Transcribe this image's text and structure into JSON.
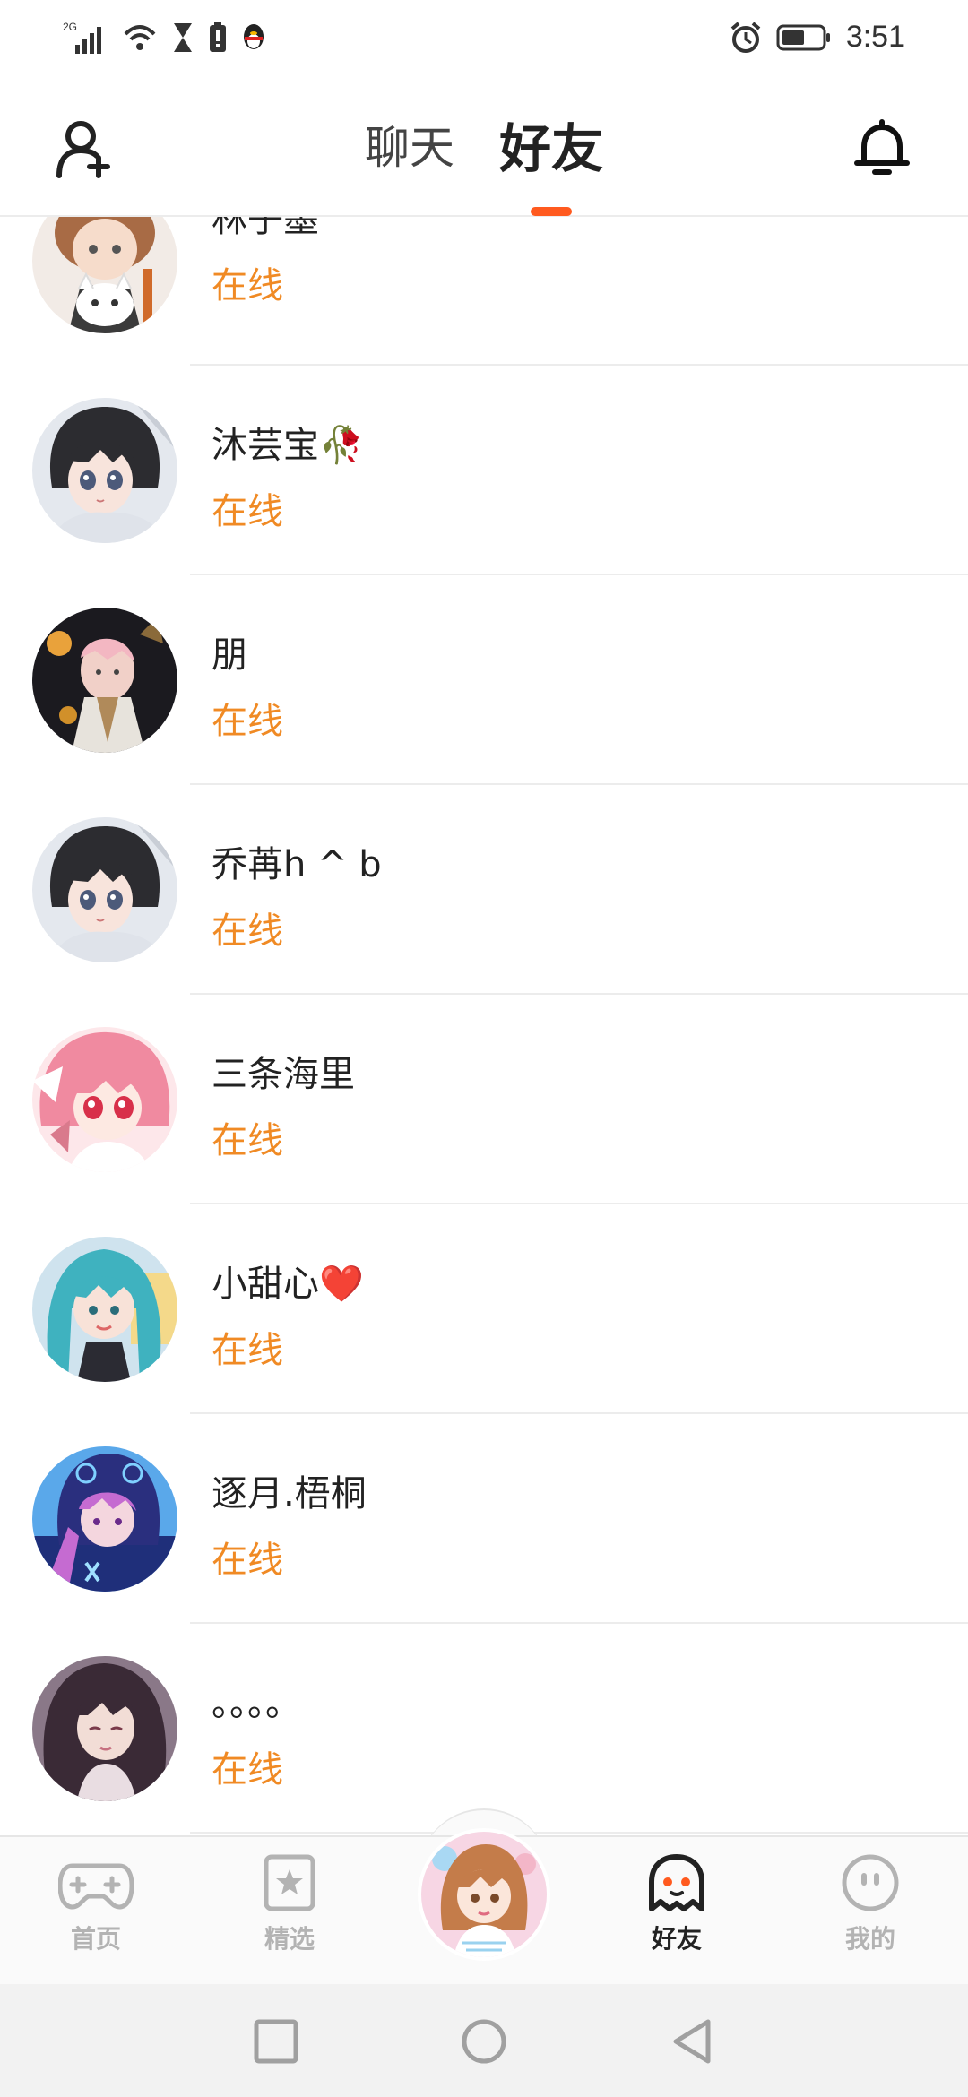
{
  "status_bar": {
    "signal_text": "2G",
    "time": "3:51"
  },
  "header": {
    "tabs": [
      {
        "label": "聊天",
        "active": false
      },
      {
        "label": "好友",
        "active": true
      }
    ],
    "icons": {
      "left": "add-friend-icon",
      "right": "bell-icon"
    },
    "accent_color": "#ff5a1f"
  },
  "friends": [
    {
      "name": "林子墨",
      "status": "在线",
      "avatar": "avatar-brown-hair-cat-mask"
    },
    {
      "name": "沐芸宝🥀",
      "status": "在线",
      "avatar": "avatar-black-hair-girl"
    },
    {
      "name": "朋",
      "status": "在线",
      "avatar": "avatar-dark-ornate"
    },
    {
      "name": "乔苒h ^ b",
      "status": "在线",
      "avatar": "avatar-black-hair-girl"
    },
    {
      "name": "三条海里",
      "status": "在线",
      "avatar": "avatar-pink-hair-girl"
    },
    {
      "name": "小甜心❤️",
      "status": "在线",
      "avatar": "avatar-teal-twin-tails"
    },
    {
      "name": "逐月.梧桐",
      "status": "在线",
      "avatar": "avatar-purple-hood"
    },
    {
      "name": "。。。。",
      "status": "在线",
      "avatar": "avatar-dark-long-hair"
    }
  ],
  "status_color": "#f08a24",
  "bottom_nav": {
    "items": [
      {
        "label": "首页",
        "icon": "gamepad-icon",
        "active": false
      },
      {
        "label": "精选",
        "icon": "star-bookmark-icon",
        "active": false
      },
      {
        "label": "",
        "icon": "center-avatar",
        "active": false
      },
      {
        "label": "好友",
        "icon": "ghost-icon",
        "active": true
      },
      {
        "label": "我的",
        "icon": "face-icon",
        "active": false
      }
    ]
  },
  "system_nav": {
    "buttons": [
      "recent-apps-icon",
      "home-icon",
      "back-icon"
    ]
  }
}
